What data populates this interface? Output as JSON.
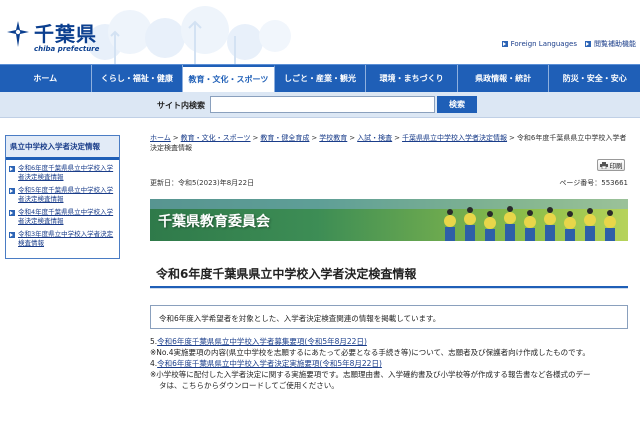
{
  "header": {
    "logo_title": "千葉県",
    "logo_sub": "chiba prefecture",
    "util_links": [
      {
        "label": "Foreign Languages"
      },
      {
        "label": "閲覧補助機能"
      }
    ]
  },
  "nav": {
    "items": [
      {
        "label": "ホーム"
      },
      {
        "label": "くらし・福祉・健康"
      },
      {
        "label": "教育・文化・スポーツ"
      },
      {
        "label": "しごと・産業・観光"
      },
      {
        "label": "環境・まちづくり"
      },
      {
        "label": "県政情報・統計"
      },
      {
        "label": "防災・安全・安心"
      }
    ],
    "active_index": 2
  },
  "search": {
    "label": "サイト内検索",
    "value": "",
    "button_label": "検索"
  },
  "sidebar": {
    "heading": "県立中学校入学者決定情報",
    "items": [
      {
        "label": "令和6年度千葉県県立中学校入学者決定検査情報"
      },
      {
        "label": "令和5年度千葉県県立中学校入学者決定検査情報"
      },
      {
        "label": "令和4年度千葉県県立中学校入学者決定検査情報"
      },
      {
        "label": "令和3年度県立中学校入学者決定検査情報"
      }
    ]
  },
  "breadcrumb": {
    "links": [
      "ホーム",
      "教育・文化・スポーツ",
      "教育・健全育成",
      "学校教育",
      "入試・検査",
      "千葉県県立中学校入学者決定情報"
    ],
    "current": "令和6年度千葉県県立中学校入学者決定検査情報"
  },
  "print_label": "印刷",
  "meta": {
    "updated": "更新日：令和5(2023)年8月22日",
    "page_number": "ページ番号：553661"
  },
  "banner": {
    "text": "千葉県教育委員会"
  },
  "page_title": "令和6年度千葉県県立中学校入学者決定検査情報",
  "intro": "令和6年度入学希望者を対象とした、入学者決定検査関連の情報を掲載しています。",
  "content": {
    "item5_prefix": "5.",
    "item5_link": "令和6年度千葉県県立中学校入学者募集要項(令和5年8月22日)",
    "item5_note": "※No.4実施要項の内容(県立中学校を志願するにあたって必要となる手続き等)について、志願者及び保護者向け作成したものです。",
    "item4_prefix": "4.",
    "item4_link": "令和6年度千葉県県立中学校入学者決定実施要項(令和5年8月22日)",
    "item4_note_line1": "※小学校等に配付した入学者決定に関する実施要項です。志願理由書、入学確約書及び小学校等が作成する報告書など各様式のデー",
    "item4_note_line2": "タは、こちらからダウンロードしてご使用ください。"
  },
  "colors": {
    "nav_blue": "#1f5fb7",
    "link": "#1a3d8a",
    "search_bg": "#dce7f4"
  }
}
